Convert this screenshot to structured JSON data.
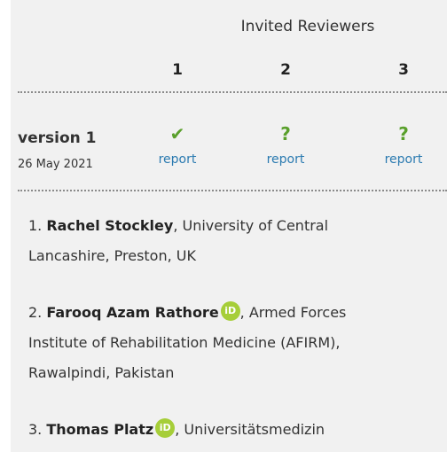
{
  "header": {
    "title": "Invited Reviewers"
  },
  "columns": [
    "1",
    "2",
    "3"
  ],
  "version": {
    "label": "version 1",
    "date": "26 May 2021",
    "statuses": [
      {
        "icon": "checkmark-icon",
        "glyph": "✔",
        "link": "report"
      },
      {
        "icon": "question-icon",
        "glyph": "?",
        "link": "report"
      },
      {
        "icon": "question-icon",
        "glyph": "?",
        "link": "report"
      }
    ]
  },
  "reviewers": [
    {
      "num": "1.",
      "name": "Rachel Stockley",
      "affiliation_line1": ", University of Central",
      "affiliation_line2": "Lancashire, Preston, UK",
      "affiliation_line3": ""
    },
    {
      "num": "2.",
      "name": "Farooq Azam Rathore",
      "orcid": "iD",
      "affiliation_line1": ", Armed Forces",
      "affiliation_line2": "Institute of Rehabilitation Medicine (AFIRM),",
      "affiliation_line3": "Rawalpindi, Pakistan"
    },
    {
      "num": "3.",
      "name": "Thomas Platz",
      "orcid": "iD",
      "affiliation_line1": ", Universitätsmedizin"
    }
  ],
  "colors": {
    "approved": "#5aa02c",
    "link": "#2a7ab0",
    "orcid": "#a6ce39"
  }
}
